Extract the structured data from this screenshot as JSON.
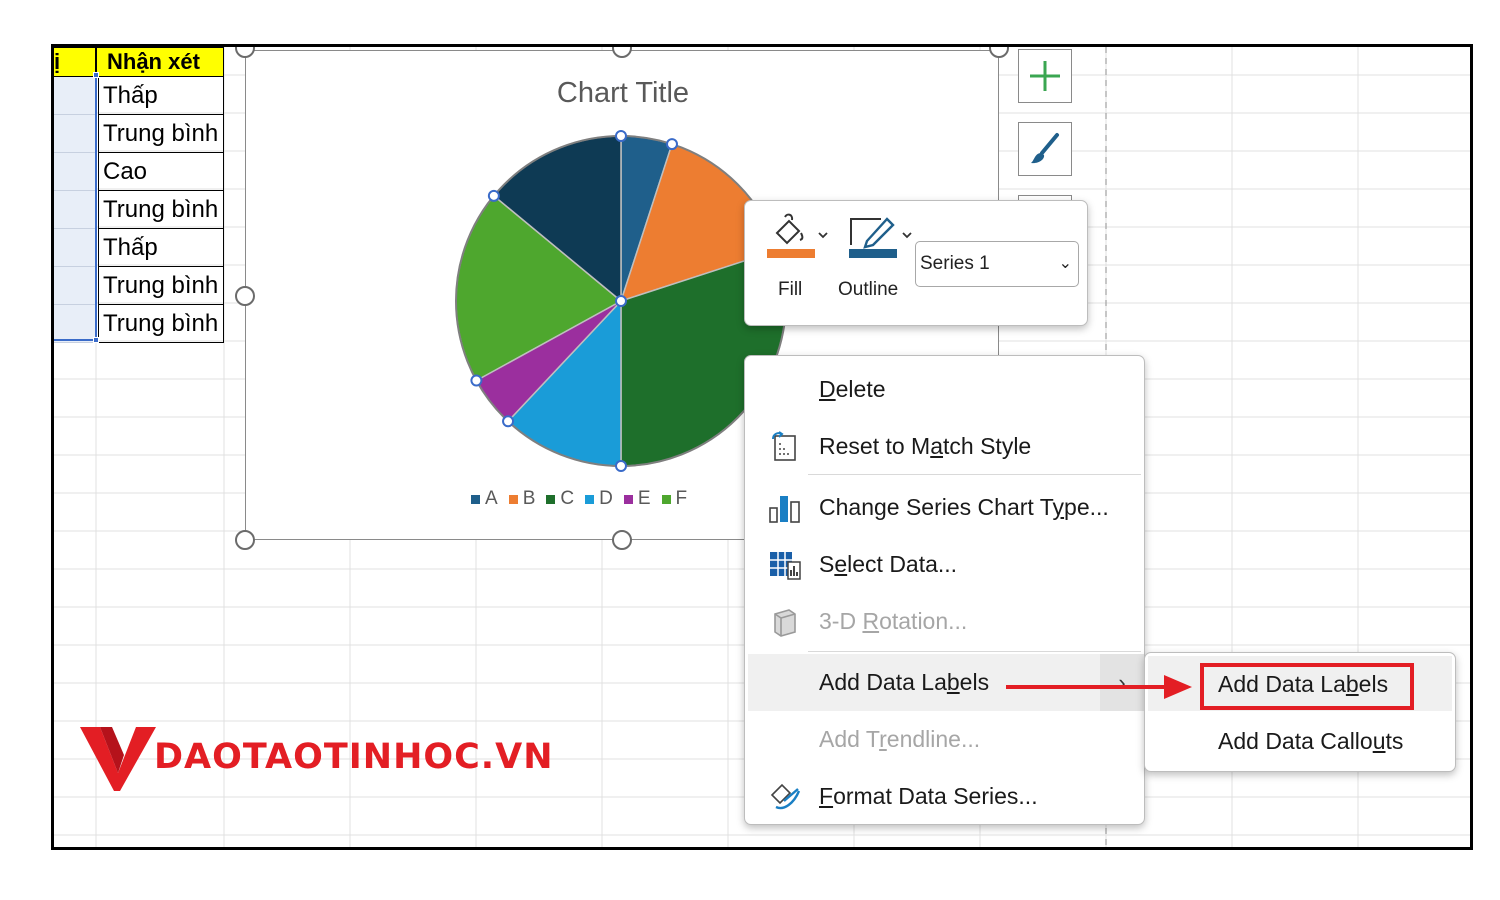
{
  "sheet": {
    "header_left": "ị",
    "header_nhan_xet": "Nhận xét",
    "rows": [
      "Thấp",
      "Trung bình",
      "Cao",
      "Trung bình",
      "Thấp",
      "Trung bình",
      "Trung bình"
    ]
  },
  "chart_data": {
    "type": "pie",
    "title": "Chart Title",
    "categories": [
      "A",
      "B",
      "C",
      "D",
      "E",
      "F"
    ],
    "values": [
      5,
      15,
      30,
      12,
      5,
      19
    ],
    "colors": [
      "#1f5f8b",
      "#ed7d31",
      "#1e6f2b",
      "#1a9cd8",
      "#9b2f9e",
      "#4ea72e"
    ],
    "extra_slice": {
      "value": 14,
      "color": "#0e3a54"
    },
    "legend": "bottom"
  },
  "mini_toolbar": {
    "fill_label": "Fill",
    "outline_label": "Outline",
    "series_value": "Series 1",
    "fill_color": "#ed7d31",
    "outline_color": "#1f5f8b"
  },
  "context_menu": {
    "delete": {
      "pre": "",
      "u": "D",
      "post": "elete"
    },
    "reset": {
      "pre": "Reset to M",
      "u": "a",
      "post": "tch Style"
    },
    "change_type": {
      "pre": "Change Series Chart T",
      "u": "y",
      "post": "pe..."
    },
    "select_data": {
      "pre": "S",
      "u": "e",
      "post": "lect Data..."
    },
    "rotation": {
      "pre": "3-D ",
      "u": "R",
      "post": "otation..."
    },
    "add_labels": {
      "pre": "Add Data La",
      "u": "b",
      "post": "els"
    },
    "trendline": {
      "pre": "Add T",
      "u": "r",
      "post": "endline..."
    },
    "format": {
      "pre": "",
      "u": "F",
      "post": "ormat Data Series..."
    }
  },
  "submenu": {
    "add_labels": {
      "pre": "Add Data La",
      "u": "b",
      "post": "els"
    },
    "add_callouts": {
      "pre": "Add Data Callo",
      "u": "u",
      "post": "ts"
    }
  },
  "logo": {
    "text": "DAOTAOTINHOC.VN"
  },
  "colors": {
    "highlight": "#e31e24",
    "selection": "#3a6bc9"
  }
}
